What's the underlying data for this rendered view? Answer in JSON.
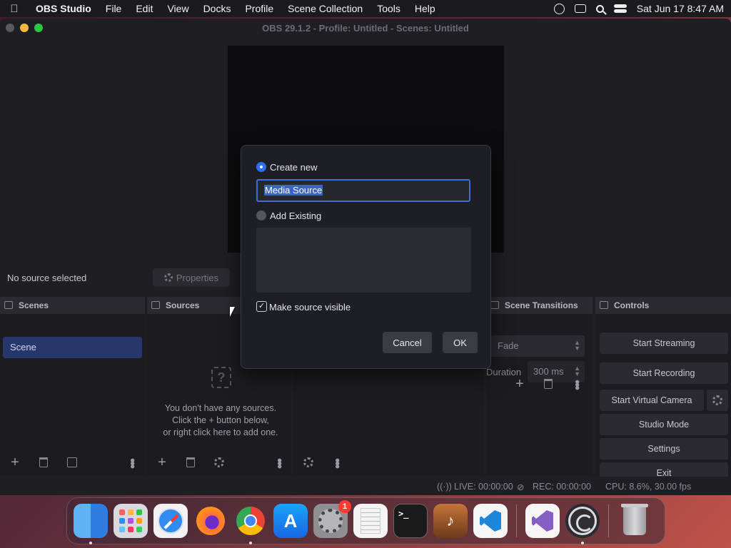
{
  "menubar": {
    "app_name": "OBS Studio",
    "items": [
      "File",
      "Edit",
      "View",
      "Docks",
      "Profile",
      "Scene Collection",
      "Tools",
      "Help"
    ],
    "clock": "Sat Jun 17  8:47 AM",
    "status_icons": [
      "obs-tray-icon",
      "window-icon",
      "search-icon",
      "control-center-icon"
    ]
  },
  "window": {
    "title": "OBS 29.1.2 - Profile: Untitled - Scenes: Untitled"
  },
  "source_bar": {
    "no_source": "No source selected",
    "properties_label": "Properties"
  },
  "docks": {
    "scenes": {
      "title": "Scenes",
      "items": [
        "Scene"
      ]
    },
    "sources": {
      "title": "Sources",
      "empty_line1": "You don't have any sources.",
      "empty_line2": "Click the + button below,",
      "empty_line3": "or right click here to add one."
    },
    "transitions": {
      "title": "Scene Transitions",
      "selected": "Fade",
      "duration_label": "Duration",
      "duration_value": "300 ms"
    },
    "controls": {
      "title": "Controls",
      "start_streaming": "Start Streaming",
      "start_recording": "Start Recording",
      "start_virtual_camera": "Start Virtual Camera",
      "studio_mode": "Studio Mode",
      "settings": "Settings",
      "exit": "Exit"
    }
  },
  "statusbar": {
    "live": "LIVE: 00:00:00",
    "rec": "REC: 00:00:00",
    "cpu": "CPU: 8.6%, 30.00 fps"
  },
  "dialog": {
    "create_new_label": "Create new",
    "name_value": "Media Source",
    "add_existing_label": "Add Existing",
    "make_visible_label": "Make source visible",
    "make_visible_checked": true,
    "cancel_label": "Cancel",
    "ok_label": "OK"
  },
  "dock_apps": {
    "settings_badge": "1",
    "terminal_prompt": ">_"
  },
  "colors": {
    "accent": "#2d6ff3",
    "scene_selected": "#28376b",
    "window_bg": "#1f1f23"
  }
}
